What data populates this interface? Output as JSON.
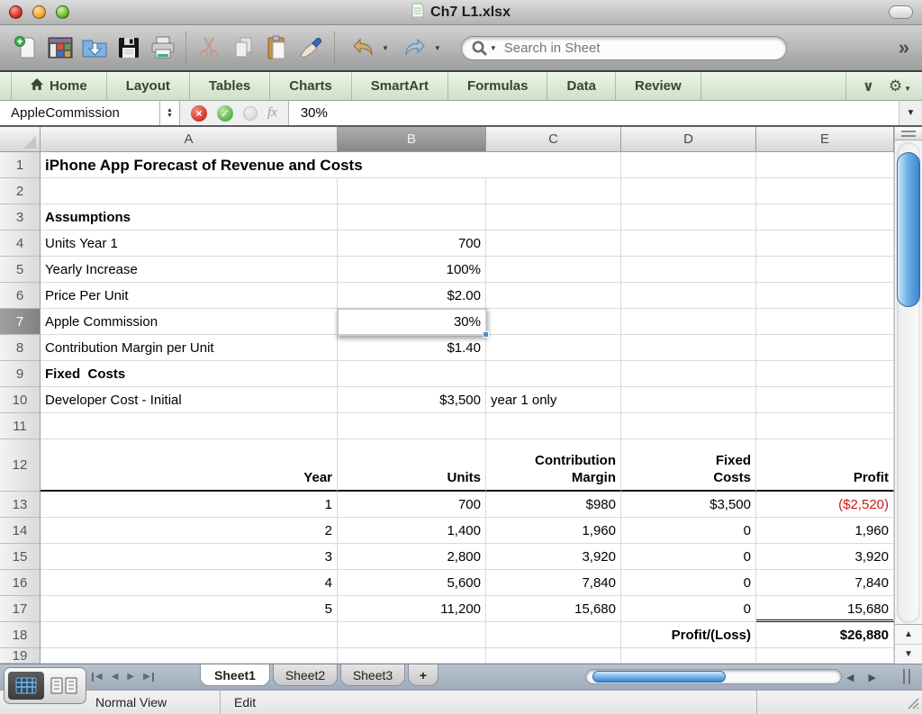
{
  "window": {
    "title": "Ch7 L1.xlsx"
  },
  "toolbar": {
    "search": {
      "placeholder": "Search in Sheet"
    },
    "overflow_chevron": "»",
    "icons": [
      "new-document",
      "template-gallery",
      "open",
      "save",
      "print",
      "cut",
      "copy",
      "paste",
      "format-painter",
      "undo",
      "redo",
      "search"
    ]
  },
  "ribbon": {
    "tabs": [
      "Home",
      "Layout",
      "Tables",
      "Charts",
      "SmartArt",
      "Formulas",
      "Data",
      "Review"
    ]
  },
  "formula_bar": {
    "name_box": "AppleCommission",
    "fx_label": "fx",
    "value": "30%"
  },
  "grid": {
    "column_headers": [
      "A",
      "B",
      "C",
      "D",
      "E"
    ],
    "selected_column": "B",
    "selected_row": 7,
    "selected_cell": "B7",
    "rows": [
      {
        "n": 1,
        "cells": [
          {
            "c": "A",
            "t": "iPhone App Forecast of Revenue and Costs",
            "b": true,
            "al": "l",
            "size": "title"
          }
        ]
      },
      {
        "n": 2,
        "cells": []
      },
      {
        "n": 3,
        "cells": [
          {
            "c": "A",
            "t": "Assumptions",
            "b": true,
            "al": "l"
          }
        ]
      },
      {
        "n": 4,
        "cells": [
          {
            "c": "A",
            "t": "Units Year 1",
            "al": "l"
          },
          {
            "c": "B",
            "t": "700",
            "al": "r"
          }
        ]
      },
      {
        "n": 5,
        "cells": [
          {
            "c": "A",
            "t": "Yearly Increase",
            "al": "l"
          },
          {
            "c": "B",
            "t": "100%",
            "al": "r"
          }
        ]
      },
      {
        "n": 6,
        "cells": [
          {
            "c": "A",
            "t": "Price Per Unit",
            "al": "l"
          },
          {
            "c": "B",
            "t": "$2.00",
            "al": "r"
          }
        ]
      },
      {
        "n": 7,
        "cells": [
          {
            "c": "A",
            "t": "Apple Commission",
            "al": "l"
          },
          {
            "c": "B",
            "t": "30%",
            "al": "r",
            "sel": true
          }
        ]
      },
      {
        "n": 8,
        "cells": [
          {
            "c": "A",
            "t": "Contribution Margin per Unit",
            "al": "l"
          },
          {
            "c": "B",
            "t": "$1.40",
            "al": "r"
          }
        ]
      },
      {
        "n": 9,
        "cells": [
          {
            "c": "A",
            "t": "Fixed  Costs",
            "b": true,
            "al": "l"
          }
        ]
      },
      {
        "n": 10,
        "cells": [
          {
            "c": "A",
            "t": "Developer Cost - Initial",
            "al": "l"
          },
          {
            "c": "B",
            "t": "$3,500",
            "al": "r"
          },
          {
            "c": "C",
            "t": "year 1 only",
            "al": "l"
          }
        ]
      },
      {
        "n": 11,
        "cells": []
      },
      {
        "n": 12,
        "tall": true,
        "thick_bottom": true,
        "cells": [
          {
            "c": "A",
            "t": "Year",
            "b": true,
            "al": "r"
          },
          {
            "c": "B",
            "t": "Units",
            "b": true,
            "al": "r"
          },
          {
            "c": "C",
            "t": "Contribution\nMargin",
            "b": true,
            "al": "r"
          },
          {
            "c": "D",
            "t": "Fixed\nCosts",
            "b": true,
            "al": "r"
          },
          {
            "c": "E",
            "t": "Profit",
            "b": true,
            "al": "r"
          }
        ]
      },
      {
        "n": 13,
        "cells": [
          {
            "c": "A",
            "t": "1",
            "al": "r"
          },
          {
            "c": "B",
            "t": "700",
            "al": "r"
          },
          {
            "c": "C",
            "t": "$980",
            "al": "r"
          },
          {
            "c": "D",
            "t": "$3,500",
            "al": "r"
          },
          {
            "c": "E",
            "t": "($2,520)",
            "al": "r",
            "red": true
          }
        ]
      },
      {
        "n": 14,
        "cells": [
          {
            "c": "A",
            "t": "2",
            "al": "r"
          },
          {
            "c": "B",
            "t": "1,400",
            "al": "r"
          },
          {
            "c": "C",
            "t": "1,960",
            "al": "r"
          },
          {
            "c": "D",
            "t": "0",
            "al": "r"
          },
          {
            "c": "E",
            "t": "1,960",
            "al": "r"
          }
        ]
      },
      {
        "n": 15,
        "cells": [
          {
            "c": "A",
            "t": "3",
            "al": "r"
          },
          {
            "c": "B",
            "t": "2,800",
            "al": "r"
          },
          {
            "c": "C",
            "t": "3,920",
            "al": "r"
          },
          {
            "c": "D",
            "t": "0",
            "al": "r"
          },
          {
            "c": "E",
            "t": "3,920",
            "al": "r"
          }
        ]
      },
      {
        "n": 16,
        "cells": [
          {
            "c": "A",
            "t": "4",
            "al": "r"
          },
          {
            "c": "B",
            "t": "5,600",
            "al": "r"
          },
          {
            "c": "C",
            "t": "7,840",
            "al": "r"
          },
          {
            "c": "D",
            "t": "0",
            "al": "r"
          },
          {
            "c": "E",
            "t": "7,840",
            "al": "r"
          }
        ]
      },
      {
        "n": 17,
        "cells": [
          {
            "c": "A",
            "t": "5",
            "al": "r"
          },
          {
            "c": "B",
            "t": "11,200",
            "al": "r"
          },
          {
            "c": "C",
            "t": "15,680",
            "al": "r"
          },
          {
            "c": "D",
            "t": "0",
            "al": "r"
          },
          {
            "c": "E",
            "t": "15,680",
            "al": "r",
            "dbl": true
          }
        ]
      },
      {
        "n": 18,
        "cells": [
          {
            "c": "D",
            "t": "Profit/(Loss)",
            "b": true,
            "al": "r"
          },
          {
            "c": "E",
            "t": "$26,880",
            "b": true,
            "al": "r"
          }
        ]
      },
      {
        "n": 19,
        "partial": true,
        "cells": []
      }
    ]
  },
  "sheet_bar": {
    "tabs": [
      {
        "label": "Sheet1",
        "active": true
      },
      {
        "label": "Sheet2",
        "active": false
      },
      {
        "label": "Sheet3",
        "active": false
      }
    ],
    "add_tab": "+"
  },
  "status_bar": {
    "view_mode": "Normal View",
    "edit_mode": "Edit"
  },
  "colors": {
    "ribbon_green": "#dfeadb",
    "negative_red": "#cf1616",
    "selection_handle_blue": "#4a90d9",
    "aqua_scrollbar": "#6fb1e8",
    "tab_bar_bluegray": "#a9b4c2"
  }
}
